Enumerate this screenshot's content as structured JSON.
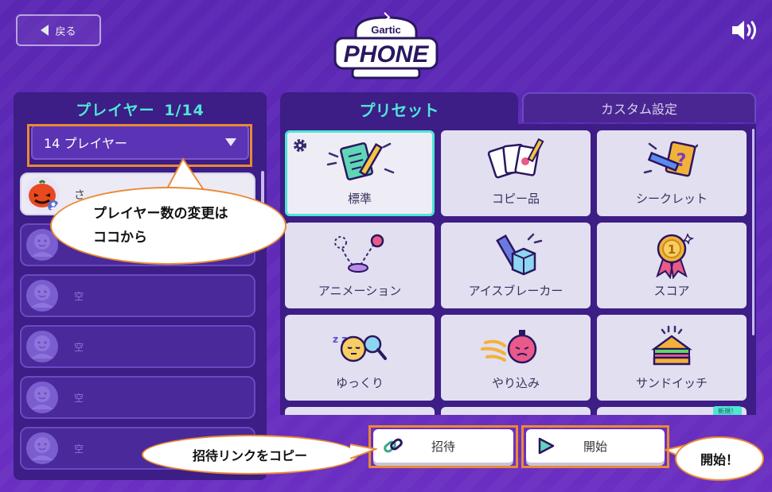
{
  "header": {
    "back_label": "戻る",
    "logo_small": "Gartic",
    "logo_big": "PHONE"
  },
  "left": {
    "title": "プレイヤー",
    "count": "1/14",
    "selector_value": "14 プレイヤー",
    "players": [
      {
        "name": "さ",
        "host": true
      },
      {
        "name": "空",
        "host": false
      },
      {
        "name": "空",
        "host": false
      },
      {
        "name": "空",
        "host": false
      },
      {
        "name": "空",
        "host": false
      },
      {
        "name": "空",
        "host": false
      }
    ]
  },
  "tabs": {
    "preset": "プリセット",
    "custom": "カスタム設定"
  },
  "presets": [
    {
      "label": "標準",
      "icon": "notepad-pencil-icon"
    },
    {
      "label": "コピー品",
      "icon": "copy-cards-icon"
    },
    {
      "label": "シークレット",
      "icon": "question-card-icon"
    },
    {
      "label": "アニメーション",
      "icon": "bouncing-ball-icon"
    },
    {
      "label": "アイスブレーカー",
      "icon": "ice-cube-icon"
    },
    {
      "label": "スコア",
      "icon": "medal-icon"
    },
    {
      "label": "ゆっくり",
      "icon": "sleepy-clock-icon"
    },
    {
      "label": "やり込み",
      "icon": "fire-stopwatch-icon"
    },
    {
      "label": "サンドイッチ",
      "icon": "sandwich-icon"
    }
  ],
  "new_badge": "新規！",
  "buttons": {
    "invite": "招待",
    "start": "開始"
  },
  "callouts": {
    "players_line1": "プレイヤー数の変更は",
    "players_line2": "ココから",
    "invite": "招待リンクをコピー",
    "start": "開始！"
  },
  "colors": {
    "accent": "#4fe6d4",
    "highlight_box": "#e98a35",
    "panel": "#3d1d86"
  }
}
